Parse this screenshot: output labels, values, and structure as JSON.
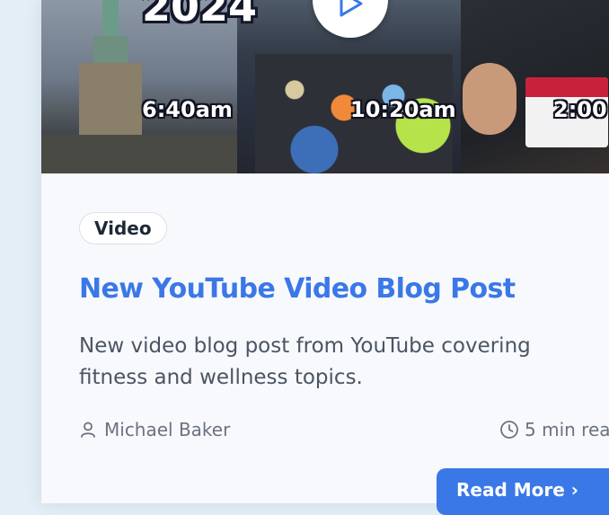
{
  "thumbnail": {
    "year": "2024",
    "times": [
      "6:40am",
      "10:20am",
      "2:00"
    ]
  },
  "card": {
    "tag": "Video",
    "title": "New YouTube Video Blog Post",
    "description": "New video blog post from YouTube covering fitness and wellness topics.",
    "author": "Michael Baker",
    "read_time": "5 min rea",
    "read_more": "Read More"
  },
  "colors": {
    "accent": "#3b78e7",
    "text": "#4b5563"
  },
  "icons": {
    "play": "play-icon",
    "author": "user-icon",
    "time": "clock-icon",
    "arrow": "arrow-right-icon"
  }
}
